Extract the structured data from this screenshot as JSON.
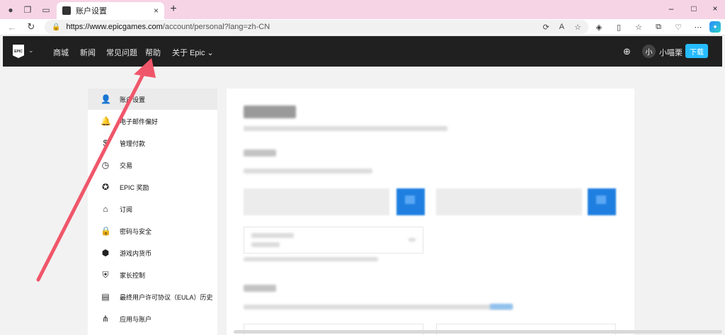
{
  "browser": {
    "tab_title": "账户设置",
    "tab_close": "×",
    "new_tab": "+",
    "url_host": "https://www.epicgames.com",
    "url_path": "/account/personal?lang=zh-CN",
    "window_controls": [
      "–",
      "□",
      "×"
    ]
  },
  "nav": {
    "logo_text": "EPIC",
    "links": [
      "商城",
      "新闻",
      "常见问题",
      "帮助",
      "关于 Epic"
    ],
    "about_caret": "⌄",
    "user_initial": "小",
    "username": "小喵栗",
    "download_label": "下载"
  },
  "sidebar": {
    "items": [
      {
        "label": "账户设置",
        "icon": "person-icon",
        "glyph": "👤",
        "active": true
      },
      {
        "label": "电子邮件偏好",
        "icon": "bell-icon",
        "glyph": "🔔",
        "active": false
      },
      {
        "label": "管理付款",
        "icon": "dollar-icon",
        "glyph": "$",
        "active": false
      },
      {
        "label": "交易",
        "icon": "clock-icon",
        "glyph": "◷",
        "active": false
      },
      {
        "label": "EPIC 奖励",
        "icon": "reward-icon",
        "glyph": "✪",
        "active": false
      },
      {
        "label": "订阅",
        "icon": "subscription-icon",
        "glyph": "⌂",
        "active": false
      },
      {
        "label": "密码与安全",
        "icon": "lock-icon",
        "glyph": "🔒",
        "active": false
      },
      {
        "label": "游戏内货币",
        "icon": "currency-icon",
        "glyph": "⬢",
        "active": false
      },
      {
        "label": "家长控制",
        "icon": "shield-icon",
        "glyph": "⛨",
        "active": false
      },
      {
        "label": "最终用户许可协议（EULA）历史",
        "icon": "document-icon",
        "glyph": "▤",
        "active": false
      },
      {
        "label": "应用与账户",
        "icon": "apps-icon",
        "glyph": "⋔",
        "active": false
      }
    ]
  },
  "colors": {
    "nav_bg": "#202020",
    "download_btn": "#26bbff",
    "blue_button": "#1f7fe0",
    "tab_strip": "#f6d4e6",
    "arrow": "#f0566a"
  }
}
